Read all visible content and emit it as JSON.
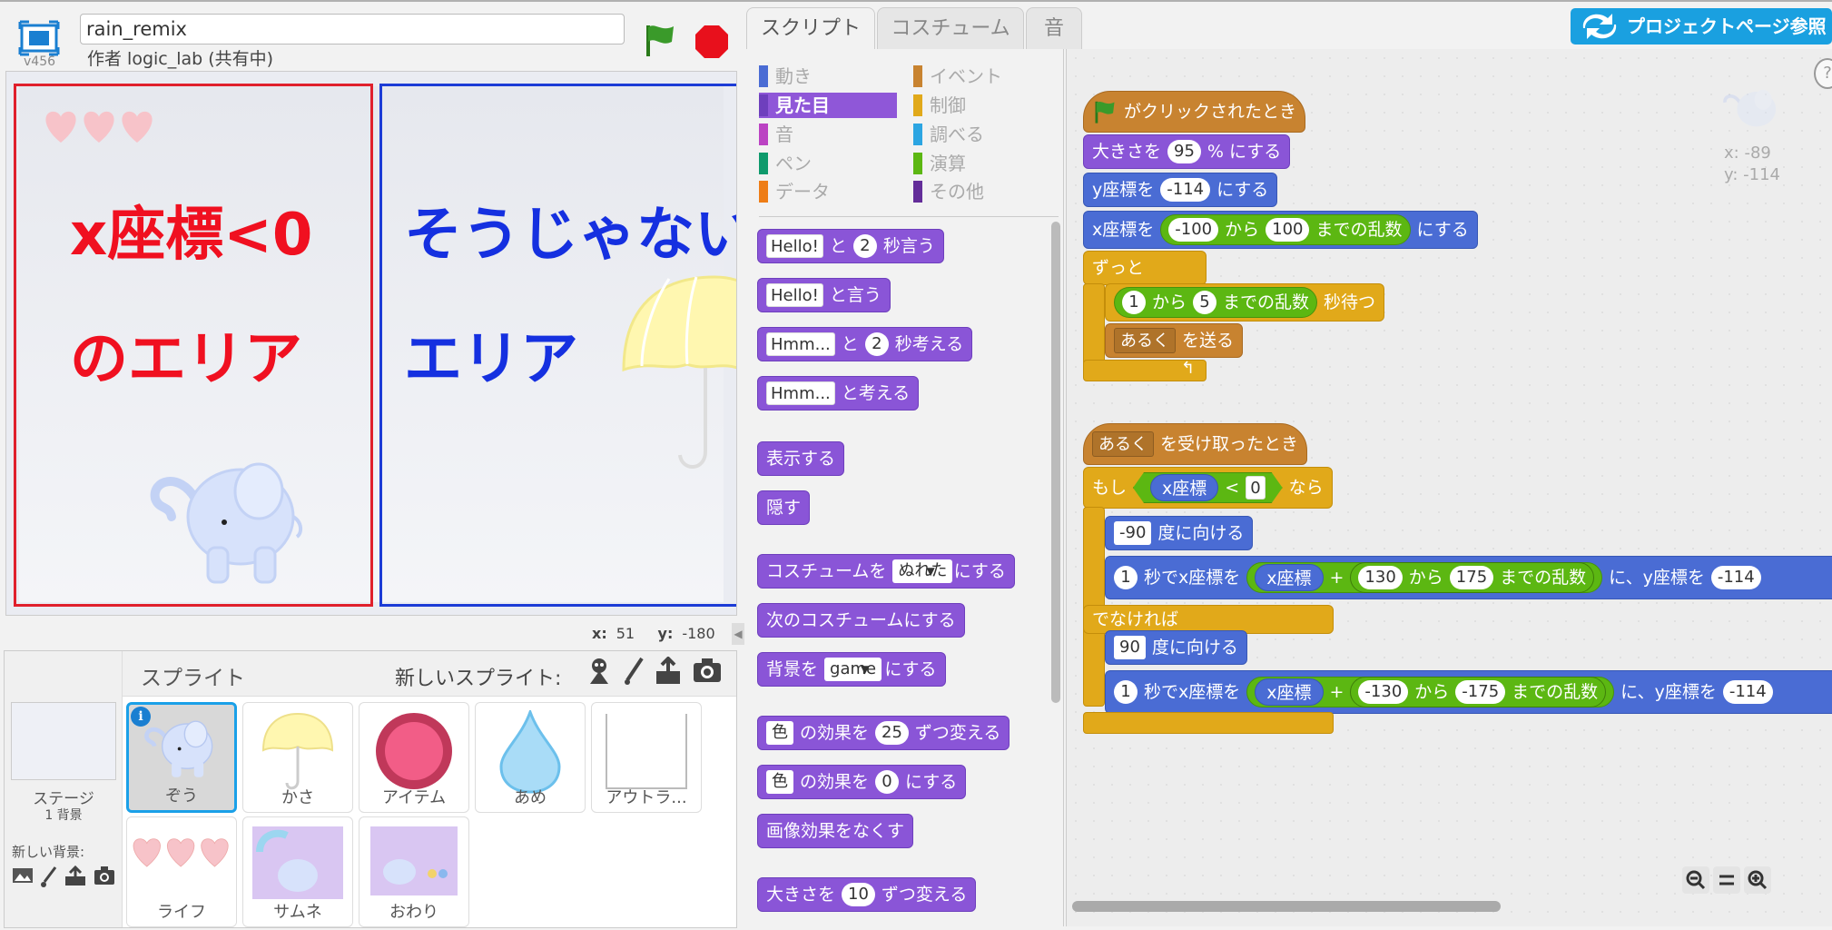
{
  "header": {
    "version": "v456",
    "project_title": "rain_remix",
    "author": "作者 logic_lab (共有中)"
  },
  "stage": {
    "left_area_line1": "x座標<0",
    "left_area_line2": "のエリア",
    "right_area_line1": "そうじゃない",
    "right_area_line2": "エリア",
    "mouse_x_label": "x:",
    "mouse_x": "51",
    "mouse_y_label": "y:",
    "mouse_y": "-180"
  },
  "sprites": {
    "title": "スプライト",
    "new_sprite": "新しいスプライト:",
    "stage_label": "ステージ",
    "stage_bg_count": "1 背景",
    "new_backdrop": "新しい背景:",
    "items": [
      {
        "label": "ぞう"
      },
      {
        "label": "かさ"
      },
      {
        "label": "アイテム"
      },
      {
        "label": "あめ"
      },
      {
        "label": "アウトラ..."
      },
      {
        "label": "ライフ"
      },
      {
        "label": "サムネ"
      },
      {
        "label": "おわり"
      }
    ]
  },
  "tabs": {
    "script": "スクリプト",
    "costume": "コスチューム",
    "sound": "音"
  },
  "project_page_button": "プロジェクトページ参照",
  "categories": [
    {
      "label": "動き",
      "color": "#4a6cd4"
    },
    {
      "label": "見た目",
      "color": "#8a55d7"
    },
    {
      "label": "音",
      "color": "#bb42c3"
    },
    {
      "label": "ペン",
      "color": "#0e9a6c"
    },
    {
      "label": "データ",
      "color": "#ee7d16"
    },
    {
      "label": "イベント",
      "color": "#c88330"
    },
    {
      "label": "制御",
      "color": "#e1a91a"
    },
    {
      "label": "調べる",
      "color": "#2ca5e2"
    },
    {
      "label": "演算",
      "color": "#5cb712"
    },
    {
      "label": "その他",
      "color": "#632d99"
    }
  ],
  "palette": {
    "say_secs": {
      "text": "Hello!",
      "mid": "と",
      "secs": "2",
      "end": "秒言う"
    },
    "say": {
      "text": "Hello!",
      "end": "と言う"
    },
    "think_secs": {
      "text": "Hmm...",
      "mid": "と",
      "secs": "2",
      "end": "秒考える"
    },
    "think": {
      "text": "Hmm...",
      "end": "と考える"
    },
    "show": "表示する",
    "hide": "隠す",
    "switch_costume": {
      "pre": "コスチュームを",
      "value": "ぬれた",
      "end": "にする"
    },
    "next_costume": "次のコスチュームにする",
    "switch_backdrop": {
      "pre": "背景を",
      "value": "game",
      "end": "にする"
    },
    "change_effect": {
      "value": "色",
      "mid": "の効果を",
      "num": "25",
      "end": "ずつ変える"
    },
    "set_effect": {
      "value": "色",
      "mid": "の効果を",
      "num": "0",
      "end": "にする"
    },
    "clear_effects": "画像効果をなくす",
    "change_size": {
      "pre": "大きさを",
      "num": "10",
      "end": "ずつ変える"
    }
  },
  "script": {
    "s1_hat": "がクリックされたとき",
    "s1_size": {
      "pre": "大きさを",
      "num": "95",
      "end": "% にする"
    },
    "s1_sety": {
      "pre": "y座標を",
      "num": "-114",
      "end": "にする"
    },
    "s1_setx": {
      "pre": "x座標を",
      "from": "-100",
      "mid": "から",
      "to": "100",
      "op": "までの乱数",
      "end": "にする"
    },
    "s1_forever": "ずっと",
    "s1_wait": {
      "from": "1",
      "mid": "から",
      "to": "5",
      "op": "までの乱数",
      "end": "秒待つ"
    },
    "s1_broadcast": {
      "value": "あるく",
      "end": "を送る"
    },
    "s2_hat": {
      "value": "あるく",
      "end": "を受け取ったとき"
    },
    "s2_if": {
      "pre": "もし",
      "rep": "x座標",
      "lt": "<",
      "num": "0",
      "end": "なら"
    },
    "s2_point1": {
      "value": "-90",
      "end": "度に向ける"
    },
    "s2_glide1": {
      "secs": "1",
      "mid": "秒でx座標を",
      "rep": "x座標",
      "plus": "+",
      "from": "130",
      "kara": "から",
      "to": "175",
      "op": "までの乱数",
      "y": "に、y座標を",
      "ynum": "-114"
    },
    "s2_else": "でなければ",
    "s2_point2": {
      "value": "90",
      "end": "度に向ける"
    },
    "s2_glide2": {
      "secs": "1",
      "mid": "秒でx座標を",
      "rep": "x座標",
      "plus": "+",
      "from": "-130",
      "kara": "から",
      "to": "-175",
      "op": "までの乱数",
      "y": "に、y座標を",
      "ynum": "-114"
    }
  },
  "sprite_info": {
    "x_label": "x:",
    "x": "-89",
    "y_label": "y:",
    "y": "-114"
  },
  "help": "?"
}
